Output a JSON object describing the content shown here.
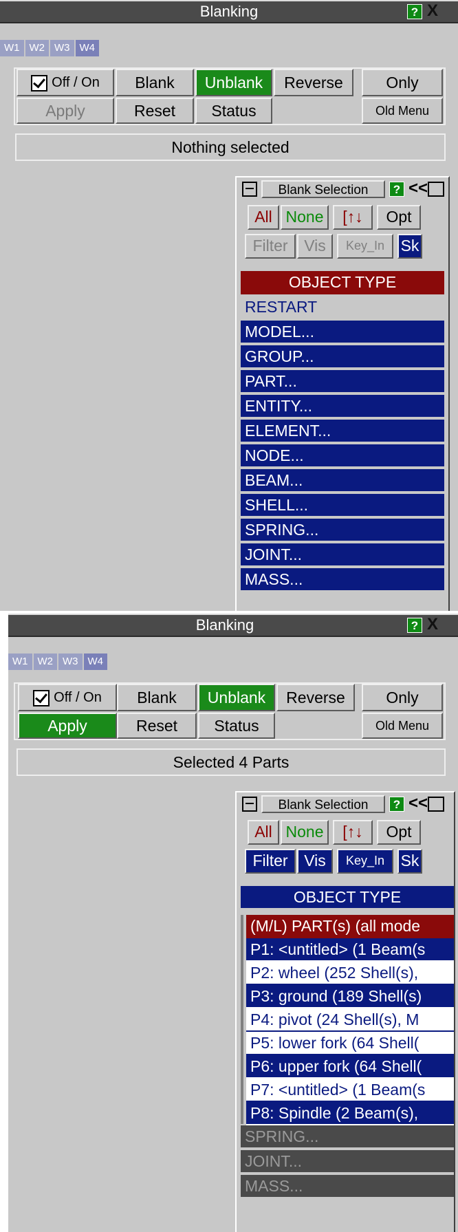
{
  "panel1": {
    "title": "Blanking",
    "help": "?",
    "close": "X",
    "tabs": [
      "W1",
      "W2",
      "W3",
      "W4"
    ],
    "buttons": {
      "offon": "Off / On",
      "blank": "Blank",
      "unblank": "Unblank",
      "reverse": "Reverse",
      "only": "Only",
      "apply": "Apply",
      "reset": "Reset",
      "status": "Status",
      "oldmenu": "Old Menu"
    },
    "status_text": "Nothing selected",
    "selection": {
      "title": "Blank Selection",
      "help": "?",
      "collapse": "<<",
      "buttons": {
        "all": "All",
        "none": "None",
        "flip": "[↑↓",
        "opt": "Opt",
        "filter": "Filter",
        "vis": "Vis",
        "keyin": "Key_In",
        "sk": "Sk"
      },
      "header": "OBJECT TYPE",
      "items": [
        "RESTART",
        "MODEL...",
        "GROUP...",
        "PART...",
        "ENTITY...",
        "ELEMENT...",
        "NODE...",
        "BEAM...",
        "SHELL...",
        "SPRING...",
        "JOINT...",
        "MASS..."
      ]
    }
  },
  "panel2": {
    "title": "Blanking",
    "help": "?",
    "close": "X",
    "tabs": [
      "W1",
      "W2",
      "W3",
      "W4"
    ],
    "buttons": {
      "offon": "Off / On",
      "blank": "Blank",
      "unblank": "Unblank",
      "reverse": "Reverse",
      "only": "Only",
      "apply": "Apply",
      "reset": "Reset",
      "status": "Status",
      "oldmenu": "Old Menu"
    },
    "status_text": "Selected 4 Parts",
    "selection": {
      "title": "Blank Selection",
      "help": "?",
      "collapse": "<<",
      "buttons": {
        "all": "All",
        "none": "None",
        "flip": "[↑↓",
        "opt": "Opt",
        "filter": "Filter",
        "vis": "Vis",
        "keyin": "Key_In",
        "sk": "Sk"
      },
      "header": "OBJECT TYPE",
      "list_header": "(M/L) PART(s) (all mode",
      "parts": [
        {
          "label": "P1: <untitled> (1 Beam(s",
          "selected": true
        },
        {
          "label": "P2: wheel (252 Shell(s),",
          "selected": false
        },
        {
          "label": "P3: ground (189 Shell(s)",
          "selected": true
        },
        {
          "label": "P4: pivot (24 Shell(s), M",
          "selected": false
        },
        {
          "label": "P5: lower fork (64 Shell(",
          "selected": false
        },
        {
          "label": "P6: upper fork (64 Shell(",
          "selected": true
        },
        {
          "label": "P7: <untitled> (1 Beam(s",
          "selected": false
        },
        {
          "label": "P8: Spindle (2 Beam(s),",
          "selected": true
        }
      ],
      "trailing": [
        "SPRING...",
        "JOINT...",
        "MASS..."
      ]
    }
  },
  "colors": {
    "navy": "#0a1a80",
    "green": "#1a8a1a",
    "red": "#8a0a0a",
    "panel": "#c8c8c8"
  }
}
